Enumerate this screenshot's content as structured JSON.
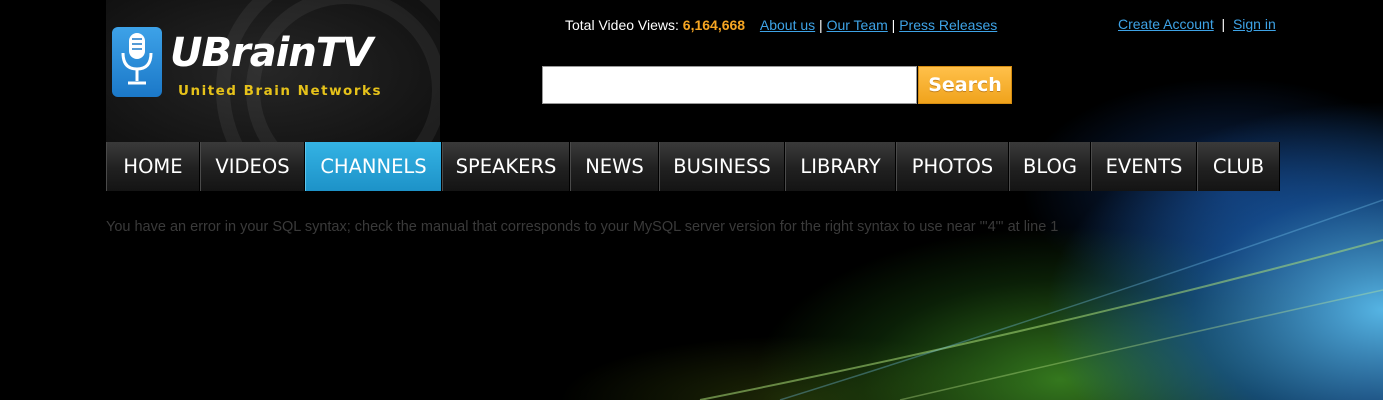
{
  "logo": {
    "title": "UBrainTV",
    "subtitle": "United Brain Networks",
    "icon": "microphone-icon"
  },
  "stats": {
    "label": "Total Video Views:",
    "value": "6,164,668"
  },
  "top_links": [
    {
      "label": "About us"
    },
    {
      "label": "Our Team"
    },
    {
      "label": "Press Releases"
    }
  ],
  "account": {
    "create_label": "Create Account",
    "signin_label": "Sign in"
  },
  "search": {
    "placeholder": "",
    "value": "",
    "button_label": "Search"
  },
  "nav": {
    "active": "CHANNELS",
    "items": [
      {
        "label": "HOME"
      },
      {
        "label": "VIDEOS"
      },
      {
        "label": "CHANNELS"
      },
      {
        "label": "SPEAKERS"
      },
      {
        "label": "NEWS"
      },
      {
        "label": "BUSINESS"
      },
      {
        "label": "LIBRARY"
      },
      {
        "label": "PHOTOS"
      },
      {
        "label": "BLOG"
      },
      {
        "label": "EVENTS"
      },
      {
        "label": "CLUB"
      }
    ]
  },
  "error_message": "You have an error in your SQL syntax; check the manual that corresponds to your MySQL server version for the right syntax to use near '\"4\"' at line 1",
  "colors": {
    "accent_blue": "#1d92c8",
    "link_blue": "#3ea3e6",
    "views_orange": "#f6a623",
    "search_orange": "#f0a31c",
    "logo_gold": "#e6c21a"
  }
}
